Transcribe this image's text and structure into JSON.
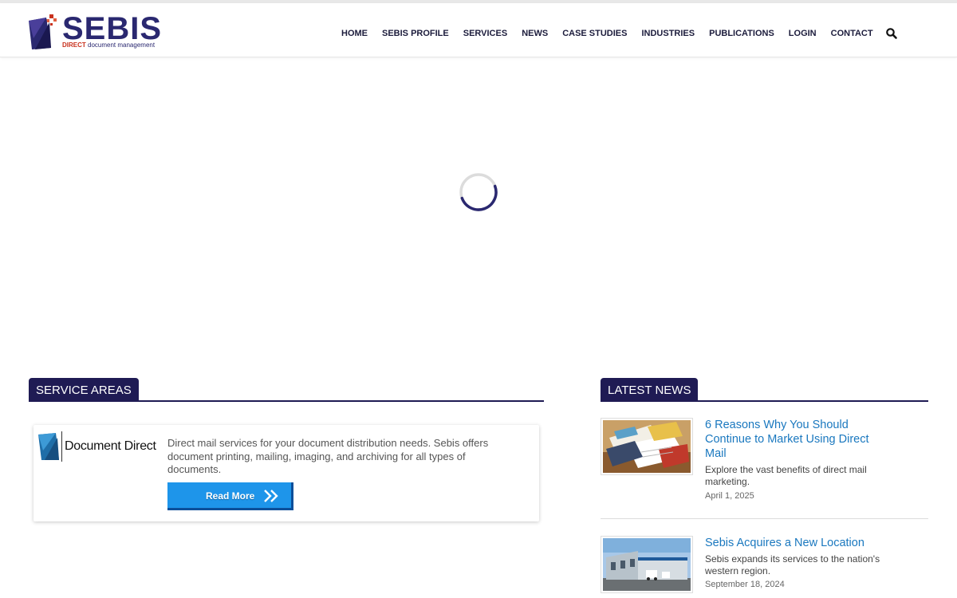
{
  "brand": {
    "name": "SEBIS",
    "tag_highlight": "DIRECT",
    "tag_rest": "document management",
    "accent": "#2a2870",
    "red": "#c8321e"
  },
  "nav": {
    "items": [
      "HOME",
      "SEBIS PROFILE",
      "SERVICES",
      "NEWS",
      "CASE STUDIES",
      "INDUSTRIES",
      "PUBLICATIONS",
      "LOGIN",
      "CONTACT"
    ],
    "search_icon": "search-icon"
  },
  "loader_icon": "spinner-icon",
  "service_areas": {
    "heading": "SERVICE AREAS",
    "card": {
      "logo_text": "Document Direct",
      "description": "Direct mail services for your document distribution needs. Sebis offers document printing, mailing, imaging, and archiving for all types of documents.",
      "button_label": "Read More"
    }
  },
  "latest_news": {
    "heading": "LATEST NEWS",
    "items": [
      {
        "title": "6 Reasons Why You Should Continue to Market Using Direct Mail",
        "excerpt": "Explore the vast benefits of direct mail marketing.",
        "date": "April 1, 2025"
      },
      {
        "title": "Sebis Acquires a New Location",
        "excerpt": "Sebis expands its services to the nation's western region.",
        "date": "September 18, 2024"
      }
    ]
  },
  "colors": {
    "navy": "#1f1b54",
    "link_blue": "#1a78bf",
    "button_blue": "#1e95ea"
  }
}
